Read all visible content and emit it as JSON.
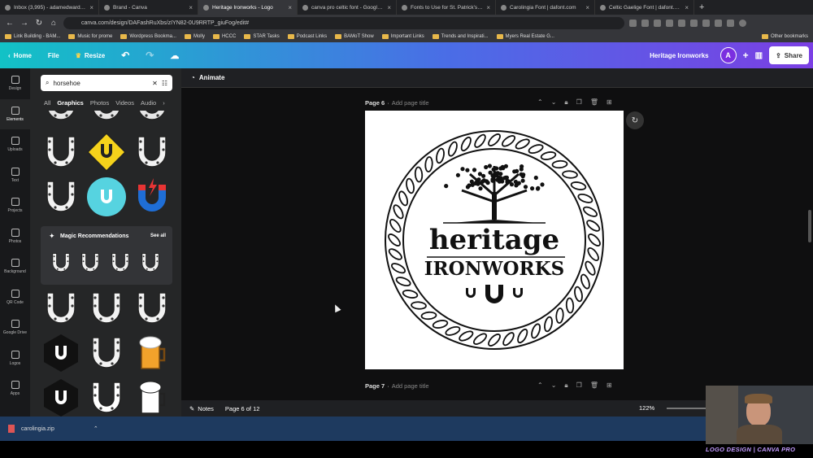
{
  "browser": {
    "tabs": [
      {
        "label": "Inbox (3,995) - adamedwardsd..."
      },
      {
        "label": "Brand - Canva"
      },
      {
        "label": "Heritage Ironworks - Logo",
        "active": true
      },
      {
        "label": "canva pro celtic font - Google S..."
      },
      {
        "label": "Fonts to Use for St. Patrick's Day"
      },
      {
        "label": "Carolingia Font | dafont.com"
      },
      {
        "label": "Celtic Gaelige Font | dafont.com"
      }
    ],
    "address": "canva.com/design/DAFashRuXbs/zIYN82-0U9RRTP_giuFog/edit#",
    "bookmarks": [
      "Link Building - BAM...",
      "Music for prome",
      "Wordpress Bookma...",
      "Molly",
      "HCCC",
      "STAR Tasks",
      "Podcast Links",
      "BAMoT Show",
      "Important Links",
      "Trends and Inspirati...",
      "Myers Real Estate G..."
    ],
    "other_bookmarks": "Other bookmarks"
  },
  "topbar": {
    "home": "Home",
    "file": "File",
    "resize": "Resize",
    "design_title": "Heritage Ironworks",
    "avatar": "A",
    "share": "Share"
  },
  "rail": [
    {
      "label": "Design",
      "icon": "layout-icon"
    },
    {
      "label": "Elements",
      "icon": "shapes-icon",
      "active": true
    },
    {
      "label": "Uploads",
      "icon": "cloud-upload-icon"
    },
    {
      "label": "Text",
      "icon": "text-icon"
    },
    {
      "label": "Projects",
      "icon": "folder-icon"
    },
    {
      "label": "Photos",
      "icon": "image-icon"
    },
    {
      "label": "Background",
      "icon": "pattern-icon"
    },
    {
      "label": "QR Code",
      "icon": "qr-icon"
    },
    {
      "label": "Google Drive",
      "icon": "drive-icon"
    },
    {
      "label": "Logos",
      "icon": "logo-icon"
    },
    {
      "label": "Apps",
      "icon": "grid-icon"
    }
  ],
  "panel": {
    "search_value": "horsehoe",
    "categories": [
      "All",
      "Graphics",
      "Photos",
      "Videos",
      "Audio"
    ],
    "active_category": "Graphics",
    "magic_title": "Magic Recommendations",
    "see_all": "See all"
  },
  "context": {
    "animate": "Animate"
  },
  "pages": {
    "current_label": "Page 6",
    "next_label": "Page 7",
    "add_title": "Add page title"
  },
  "logo": {
    "line1": "heritage",
    "line2": "IRONWORKS"
  },
  "footer": {
    "notes": "Notes",
    "page_count": "Page 6 of 12",
    "zoom": "122%"
  },
  "downloads": {
    "file": "carolingia.zip"
  },
  "watermark": "LOGO DESIGN | CANVA PRO",
  "colors": {
    "accent_start": "#12c2c6",
    "accent_end": "#7b3fe4",
    "yellow": "#f5d21b",
    "cyan": "#56d3e0",
    "red": "#e83434",
    "blue": "#1f6ed6"
  }
}
